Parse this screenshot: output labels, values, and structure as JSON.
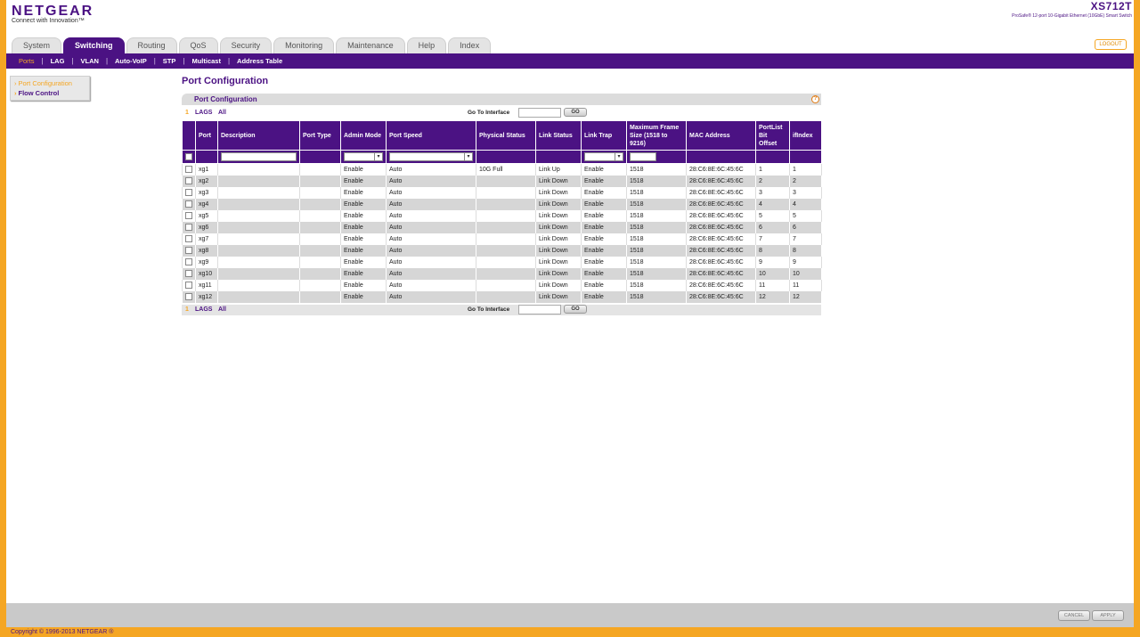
{
  "brand": {
    "logo": "NETGEAR",
    "tagline": "Connect with Innovation™",
    "model": "XS712T",
    "model_desc": "ProSafe® 12-port 10-Gigabit Ethernet (10GbE) Smart Switch",
    "logout": "LOGOUT"
  },
  "tabs": [
    "System",
    "Switching",
    "Routing",
    "QoS",
    "Security",
    "Monitoring",
    "Maintenance",
    "Help",
    "Index"
  ],
  "active_tab": "Switching",
  "subnav": [
    "Ports",
    "LAG",
    "VLAN",
    "Auto-VoIP",
    "STP",
    "Multicast",
    "Address Table"
  ],
  "active_subnav": "Ports",
  "left_menu": [
    "Port Configuration",
    "Flow Control"
  ],
  "active_left_menu": "Port Configuration",
  "page": {
    "title": "Port Configuration",
    "section_title": "Port Configuration",
    "help_icon": "help-icon"
  },
  "nav": {
    "page_number": "1",
    "lags": "LAGS",
    "all": "All",
    "goto_label": "Go To Interface",
    "go_button": "GO"
  },
  "table": {
    "headers": [
      "",
      "Port",
      "Description",
      "Port Type",
      "Admin Mode",
      "Port Speed",
      "Physical Status",
      "Link Status",
      "Link Trap",
      "Maximum Frame Size (1518 to 9216)",
      "MAC Address",
      "PortList Bit Offset",
      "ifIndex"
    ],
    "rows": [
      [
        "xg1",
        "",
        "",
        "Enable",
        "Auto",
        "10G Full",
        "Link Up",
        "Enable",
        "1518",
        "28:C6:8E:6C:45:6C",
        "1",
        "1"
      ],
      [
        "xg2",
        "",
        "",
        "Enable",
        "Auto",
        "",
        "Link Down",
        "Enable",
        "1518",
        "28:C6:8E:6C:45:6C",
        "2",
        "2"
      ],
      [
        "xg3",
        "",
        "",
        "Enable",
        "Auto",
        "",
        "Link Down",
        "Enable",
        "1518",
        "28:C6:8E:6C:45:6C",
        "3",
        "3"
      ],
      [
        "xg4",
        "",
        "",
        "Enable",
        "Auto",
        "",
        "Link Down",
        "Enable",
        "1518",
        "28:C6:8E:6C:45:6C",
        "4",
        "4"
      ],
      [
        "xg5",
        "",
        "",
        "Enable",
        "Auto",
        "",
        "Link Down",
        "Enable",
        "1518",
        "28:C6:8E:6C:45:6C",
        "5",
        "5"
      ],
      [
        "xg6",
        "",
        "",
        "Enable",
        "Auto",
        "",
        "Link Down",
        "Enable",
        "1518",
        "28:C6:8E:6C:45:6C",
        "6",
        "6"
      ],
      [
        "xg7",
        "",
        "",
        "Enable",
        "Auto",
        "",
        "Link Down",
        "Enable",
        "1518",
        "28:C6:8E:6C:45:6C",
        "7",
        "7"
      ],
      [
        "xg8",
        "",
        "",
        "Enable",
        "Auto",
        "",
        "Link Down",
        "Enable",
        "1518",
        "28:C6:8E:6C:45:6C",
        "8",
        "8"
      ],
      [
        "xg9",
        "",
        "",
        "Enable",
        "Auto",
        "",
        "Link Down",
        "Enable",
        "1518",
        "28:C6:8E:6C:45:6C",
        "9",
        "9"
      ],
      [
        "xg10",
        "",
        "",
        "Enable",
        "Auto",
        "",
        "Link Down",
        "Enable",
        "1518",
        "28:C6:8E:6C:45:6C",
        "10",
        "10"
      ],
      [
        "xg11",
        "",
        "",
        "Enable",
        "Auto",
        "",
        "Link Down",
        "Enable",
        "1518",
        "28:C6:8E:6C:45:6C",
        "11",
        "11"
      ],
      [
        "xg12",
        "",
        "",
        "Enable",
        "Auto",
        "",
        "Link Down",
        "Enable",
        "1518",
        "28:C6:8E:6C:45:6C",
        "12",
        "12"
      ]
    ]
  },
  "buttons": {
    "cancel": "CANCEL",
    "apply": "APPLY"
  },
  "footer": {
    "copyright": "Copyright © 1996-2013 NETGEAR ®"
  },
  "colors": {
    "brand_purple": "#4b1283",
    "accent_orange": "#f5a623"
  }
}
